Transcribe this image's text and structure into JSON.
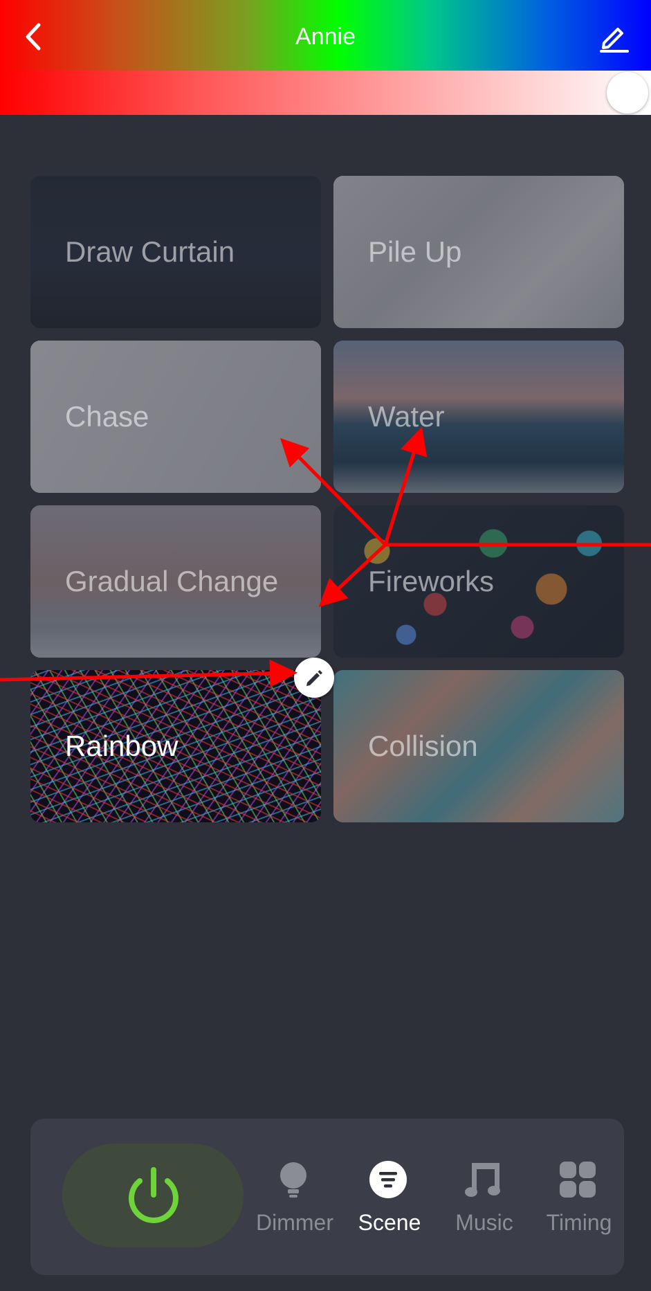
{
  "header": {
    "title": "Annie",
    "back_icon": "chevron-left-icon",
    "edit_icon": "pencil-icon"
  },
  "brightness_slider": {
    "value": 1.0
  },
  "scenes": [
    {
      "label": "Draw Curtain",
      "selected": false
    },
    {
      "label": "Pile Up",
      "selected": false
    },
    {
      "label": "Chase",
      "selected": false
    },
    {
      "label": "Water",
      "selected": false
    },
    {
      "label": "Gradual Change",
      "selected": false
    },
    {
      "label": "Fireworks",
      "selected": false
    },
    {
      "label": "Rainbow",
      "selected": true
    },
    {
      "label": "Collision",
      "selected": false
    }
  ],
  "scene_edit_badge": {
    "icon": "pencil-icon"
  },
  "bottom_bar": {
    "power_icon": "power-icon",
    "power_color": "#6fd43a",
    "tabs": [
      {
        "label": "Dimmer",
        "icon": "bulb-icon",
        "active": false
      },
      {
        "label": "Scene",
        "icon": "scene-icon",
        "active": true
      },
      {
        "label": "Music",
        "icon": "music-note-icon",
        "active": false
      },
      {
        "label": "Timing",
        "icon": "grid-icon",
        "active": false
      }
    ]
  },
  "colors": {
    "background": "#2d3039",
    "annotation_arrow": "#ff0000"
  }
}
